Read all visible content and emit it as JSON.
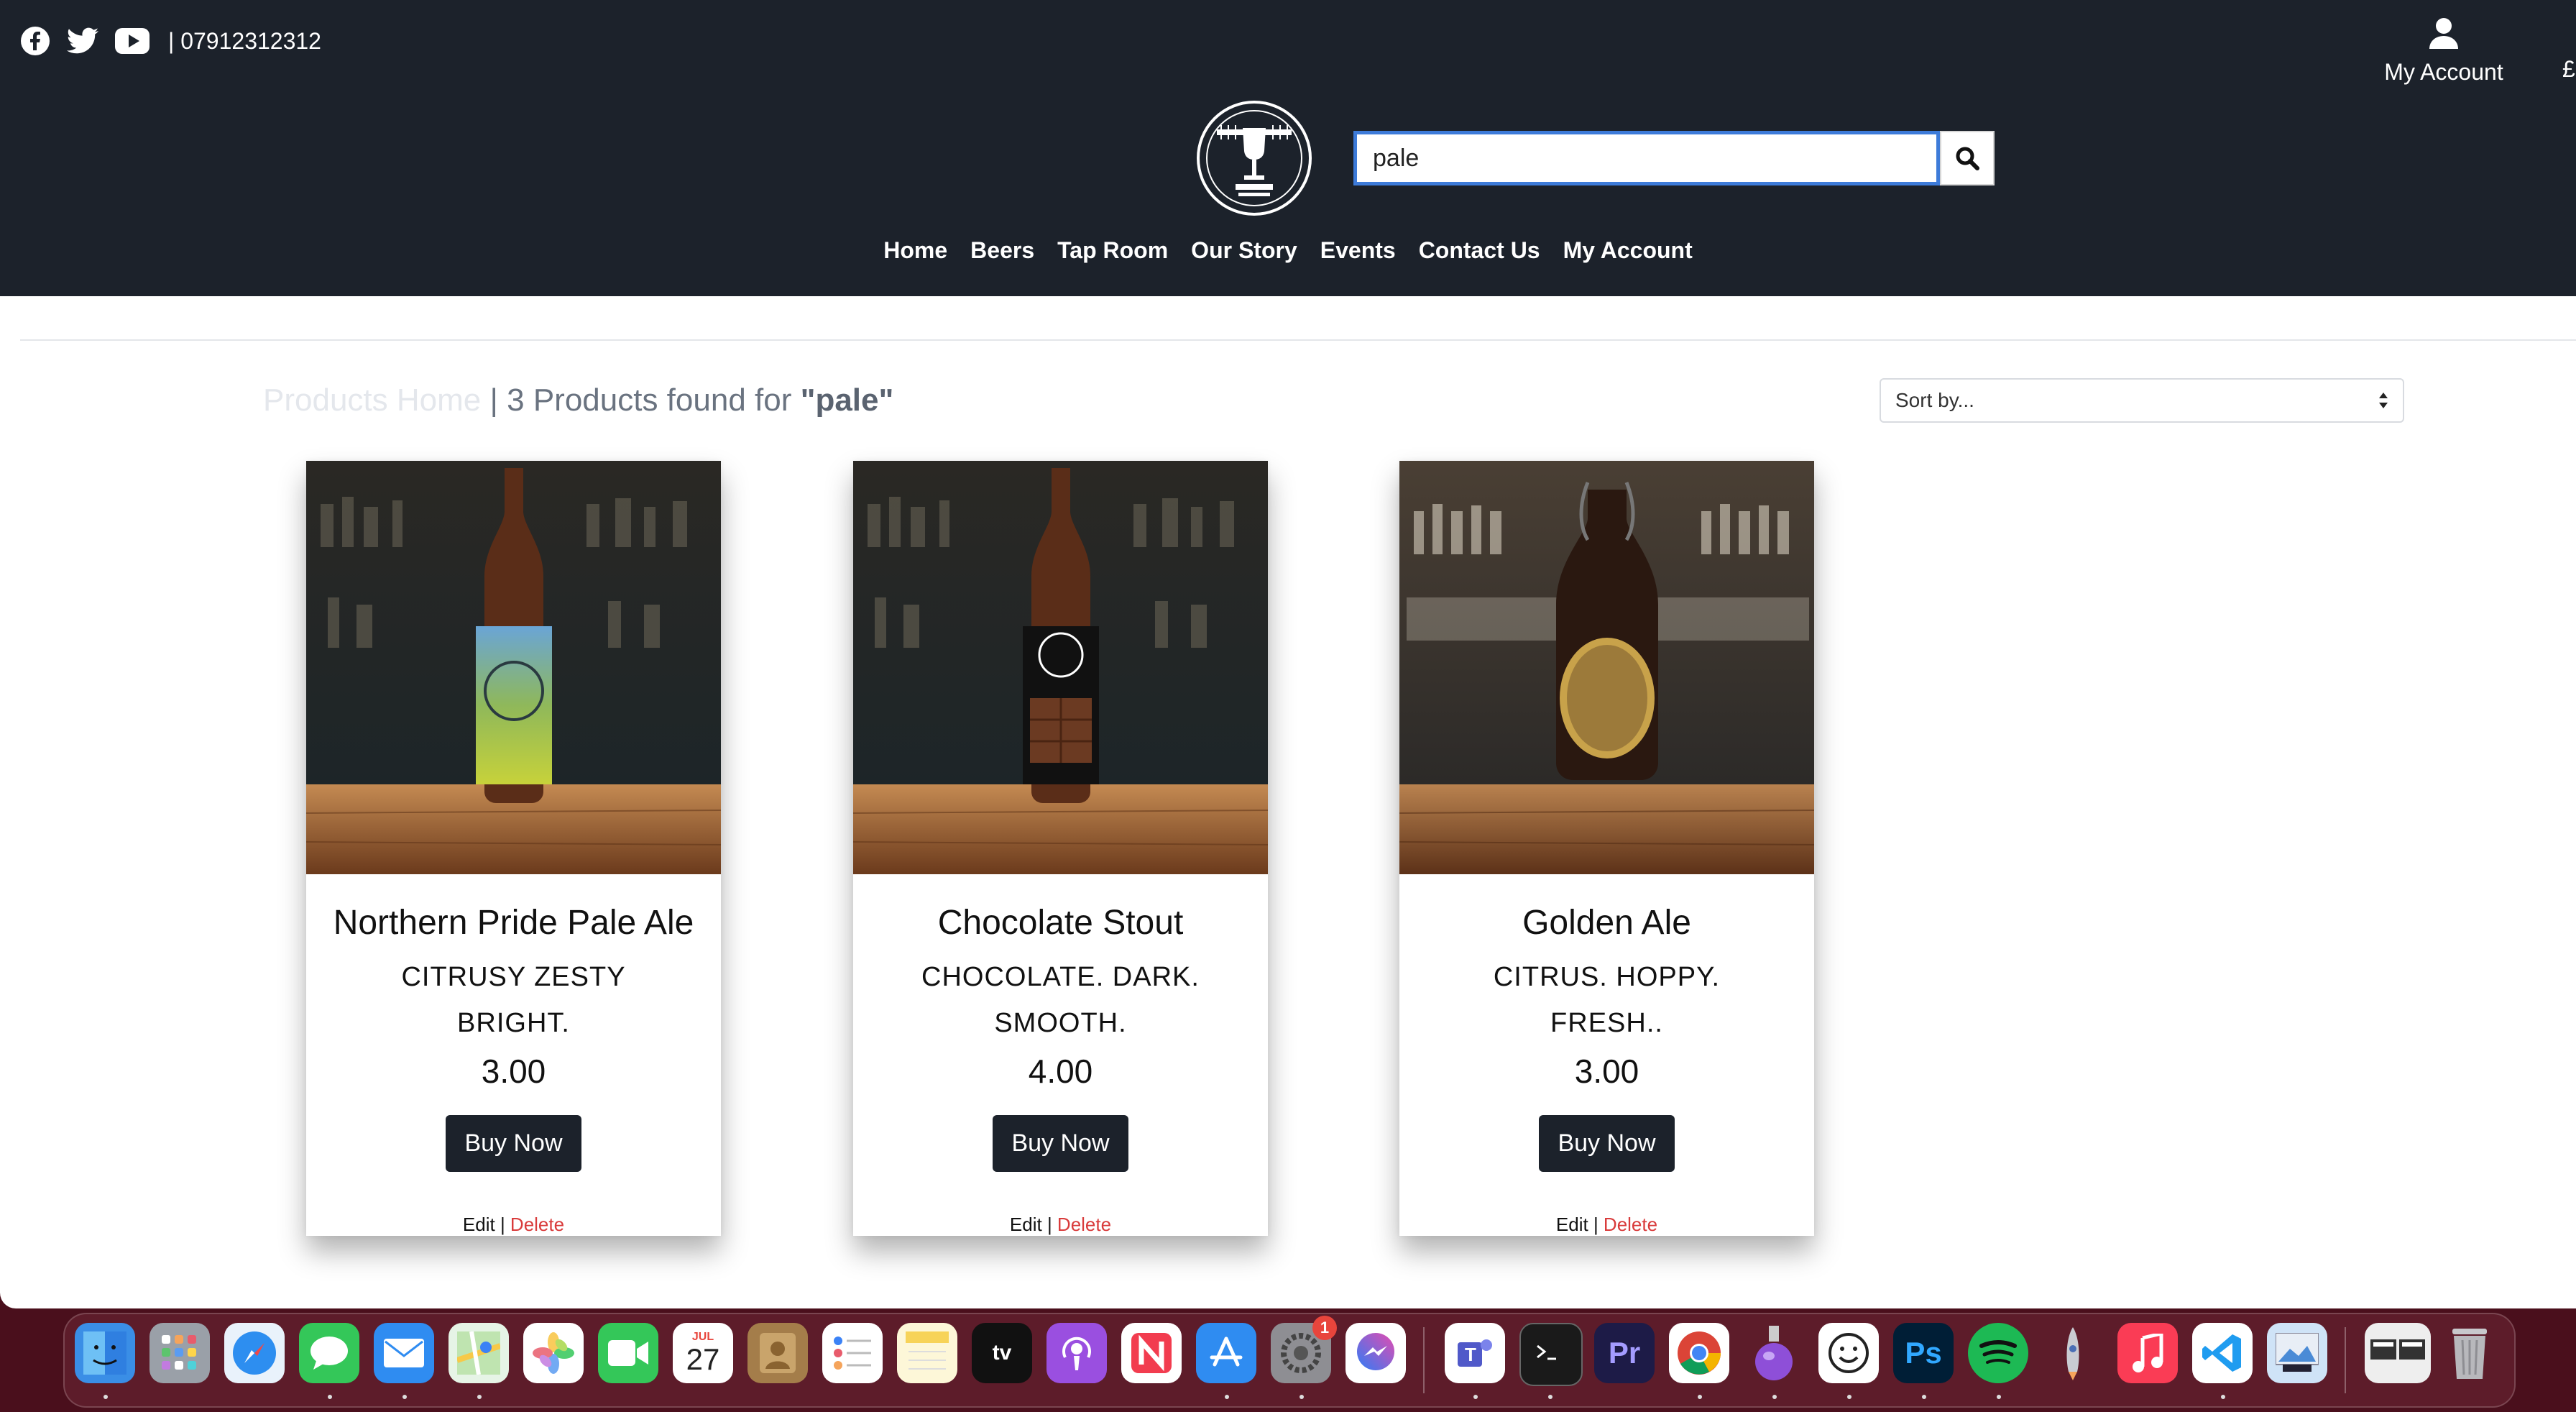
{
  "header": {
    "phone": "| 07912312312",
    "account_label": "My Account",
    "currency": "£",
    "search_value": "pale"
  },
  "nav": [
    "Home",
    "Beers",
    "Tap Room",
    "Our Story",
    "Events",
    "Contact Us",
    "My Account"
  ],
  "page": {
    "title": "Products",
    "breadcrumb_ghost": "Products Home",
    "results_prefix": "| 3 Products found for",
    "results_query": "\"pale\"",
    "sort_label": "Sort by..."
  },
  "products": [
    {
      "name": "Northern Pride Pale Ale",
      "desc": "CITRUSY ZESTY BRIGHT.",
      "price": "3.00",
      "buy": "Buy Now",
      "edit": "Edit",
      "delete": "Delete"
    },
    {
      "name": "Chocolate Stout",
      "desc": "CHOCOLATE.  DARK.  SMOOTH.",
      "price": "4.00",
      "buy": "Buy Now",
      "edit": "Edit",
      "delete": "Delete"
    },
    {
      "name": "Golden Ale",
      "desc": "CITRUS.  HOPPY.  FRESH..",
      "price": "3.00",
      "buy": "Buy Now",
      "edit": "Edit",
      "delete": "Delete"
    }
  ],
  "admin_sep": " | ",
  "dock": {
    "calendar_month": "JUL",
    "calendar_day": "27",
    "settings_badge": "1",
    "tv_label": "tv",
    "pr_label": "Pr",
    "ps_label": "Ps"
  },
  "colors": {
    "header_bg": "#1c222b",
    "delete_red": "#d93b3b",
    "search_focus": "#3d7bd9"
  }
}
